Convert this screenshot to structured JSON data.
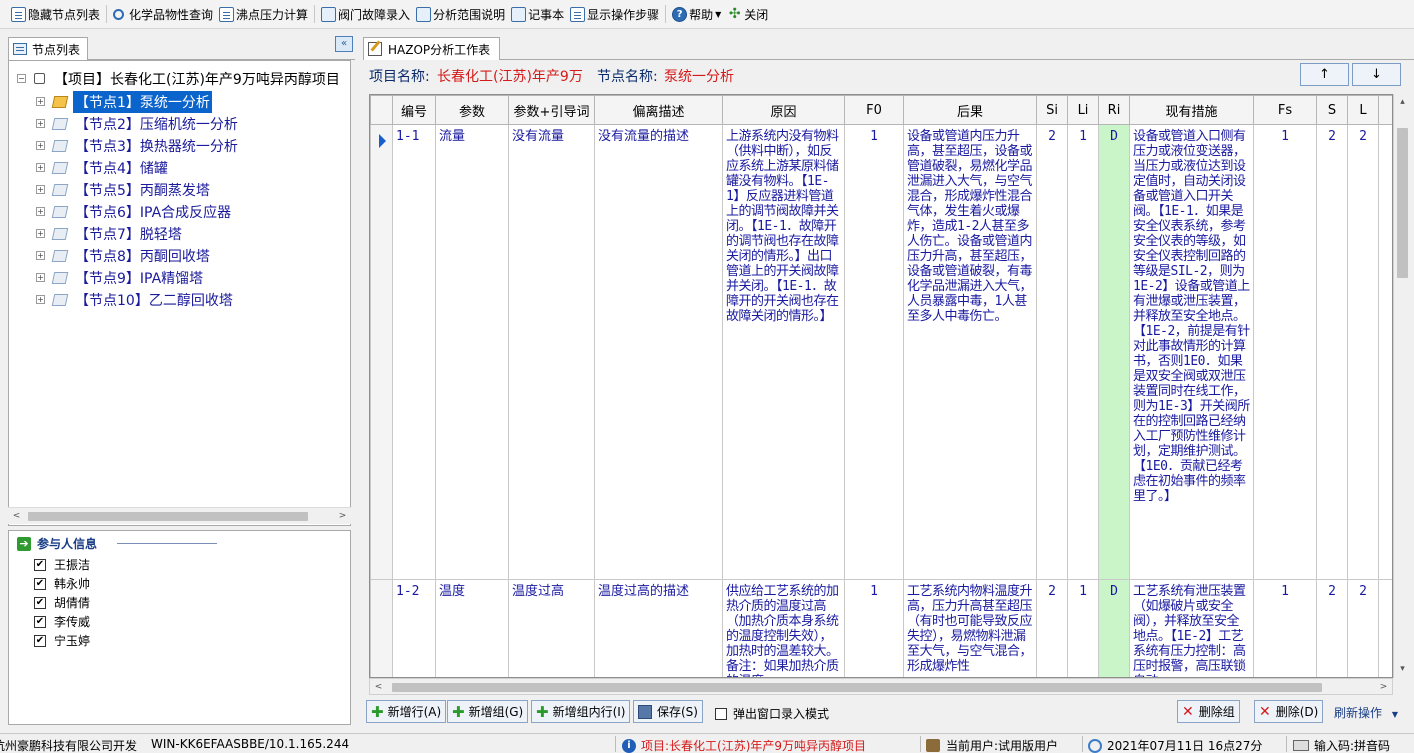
{
  "toolbar": [
    {
      "label": "隐藏节点列表",
      "icon": "list-icon",
      "name": "hide-node-list-button"
    },
    {
      "label": "化学品物性查询",
      "icon": "search-icon",
      "name": "chemical-property-query-button"
    },
    {
      "label": "沸点压力计算",
      "icon": "document-icon",
      "name": "boiling-point-pressure-button"
    },
    {
      "label": "阀门故障录入",
      "icon": "valve-icon",
      "name": "valve-fault-entry-button"
    },
    {
      "label": "分析范围说明",
      "icon": "scope-icon",
      "name": "analysis-scope-button"
    },
    {
      "label": "记事本",
      "icon": "notepad-icon",
      "name": "notepad-button"
    },
    {
      "label": "显示操作步骤",
      "icon": "steps-icon",
      "name": "show-steps-button"
    },
    {
      "label": "帮助",
      "icon": "help-icon",
      "name": "help-button"
    },
    {
      "label": "关闭",
      "icon": "close-icon",
      "name": "close-button"
    }
  ],
  "left": {
    "tab_label": "节点列表",
    "project_label": "【项目】长春化工(江苏)年产9万吨异丙醇项目",
    "nodes": [
      "【节点1】泵统一分析",
      "【节点2】压缩机统一分析",
      "【节点3】换热器统一分析",
      "【节点4】储罐",
      "【节点5】丙酮蒸发塔",
      "【节点6】IPA合成反应器",
      "【节点7】脱轻塔",
      "【节点8】丙酮回收塔",
      "【节点9】IPA精馏塔",
      "【节点10】乙二醇回收塔"
    ],
    "selected_index": 0
  },
  "participants": {
    "title": "参与人信息",
    "people": [
      "王振洁",
      "韩永帅",
      "胡倩倩",
      "李传威",
      "宁玉婷"
    ],
    "check_mark": "✔"
  },
  "work": {
    "tab_label": "HAZOP分析工作表",
    "project_name_label": "项目名称:",
    "project_name_value": "长春化工(江苏)年产9万",
    "node_name_label": "节点名称:",
    "node_name_value": "泵统一分析",
    "up_label": "↑",
    "down_label": "↓"
  },
  "table": {
    "headers": [
      "编号",
      "参数",
      "参数+引导词",
      "偏离描述",
      "原因",
      "F0",
      "后果",
      "Si",
      "Li",
      "Ri",
      "现有措施",
      "Fs",
      "S",
      "L"
    ],
    "rows": [
      {
        "id": "1-1",
        "param": "流量",
        "guide": "没有流量",
        "deviation": "没有流量的描述",
        "cause": "上游系统内没有物料（供料中断），如反应系统上游某原料储罐没有物料。【1E-1】反应器进料管道上的调节阀故障并关闭。【1E-1．故障开的调节阀也存在故障关闭的情形。】出口管道上的开关阀故障并关闭。【1E-1．故障开的开关阀也存在故障关闭的情形。】",
        "f0": "1",
        "consequence": "设备或管道内压力升高，甚至超压，设备或管道破裂，易燃化学品泄漏进入大气，与空气混合，形成爆炸性混合气体，发生着火或爆炸，造成1-2人甚至多人伤亡。设备或管道内压力升高，甚至超压，设备或管道破裂，有毒化学品泄漏进入大气，人员暴露中毒，1人甚至多人中毒伤亡。",
        "si": "2",
        "li": "1",
        "ri": "D",
        "measures": "设备或管道入口侧有压力或液位变送器，当压力或液位达到设定值时，自动关闭设备或管道入口开关阀。【1E-1．如果是安全仪表系统，参考安全仪表的等级，如安全仪表控制回路的等级是SIL-2，则为1E-2】设备或管道上有泄爆或泄压装置，并释放至安全地点。【1E-2，前提是有针对此事故情形的计算书，否则1E0．如果是双安全阀或双泄压装置同时在线工作，则为1E-3】开关阀所在的控制回路已经纳入工厂预防性维修计划，定期维护测试。【1E0．贡献已经考虑在初始事件的频率里了。】",
        "fs": "1",
        "s": "2",
        "l": "2"
      },
      {
        "id": "1-2",
        "param": "温度",
        "guide": "温度过高",
        "deviation": "温度过高的描述",
        "cause": "供应给工艺系统的加热介质的温度过高（加热介质本身系统的温度控制失效），加热时的温差较大。备注：如果加热介质的温度",
        "f0": "1",
        "consequence": "工艺系统内物料温度升高，压力升高甚至超压（有时也可能导致反应失控），易燃物料泄漏至大气，与空气混合，形成爆炸性",
        "si": "2",
        "li": "1",
        "ri": "D",
        "measures": "工艺系统有泄压装置（如爆破片或安全阀），并释放至安全地点。【1E-2】工艺系统有压力控制：高压时报警，高压联锁自动",
        "fs": "1",
        "s": "2",
        "l": "2"
      }
    ]
  },
  "bottom": {
    "add_row": "新增行(A)",
    "add_group": "新增组(G)",
    "add_group_row": "新增组内行(I)",
    "save": "保存(S)",
    "popup_mode": "弹出窗口录入模式",
    "delete_group": "删除组",
    "delete": "删除(D)",
    "refresh": "刷新操作"
  },
  "status": {
    "company": "杭州豪鹏科技有限公司开发",
    "machine": "WIN-KK6EFAASBBE/10.1.165.244",
    "project": "项目:长春化工(江苏)年产9万吨异丙醇项目",
    "user": "当前用户:试用版用户",
    "datetime": "2021年07月11日  16点27分",
    "ime": "输入码:拼音码"
  },
  "colors": {
    "accent_blue": "#0a64cc",
    "value_red": "#d41a1a",
    "ri_green": "#c9f5c9",
    "text_blue": "#1a1aa0"
  }
}
